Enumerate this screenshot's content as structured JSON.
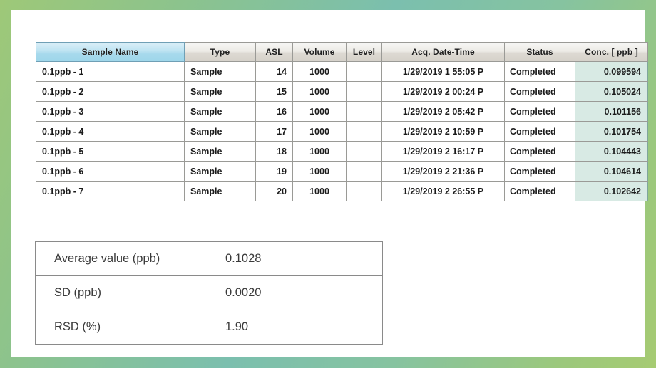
{
  "frame": {
    "border_gradient_start": "#9ec878",
    "border_gradient_mid": "#7bbfae",
    "border_gradient_end": "#a6cb72",
    "page_background": "#ffffff"
  },
  "sequence_table": {
    "selected_column": "Sample Name",
    "selected_header_color": "#a6d9ec",
    "conc_cell_color": "#d8eae4",
    "headers": [
      "Sample Name",
      "Type",
      "ASL",
      "Volume",
      "Level",
      "Acq. Date-Time",
      "Status",
      "Conc. [ ppb ]"
    ],
    "rows": [
      {
        "sample_name": "0.1ppb - 1",
        "type": "Sample",
        "asl": "14",
        "volume": "1000",
        "level": "",
        "acq_date_time": "1/29/2019 1 55:05 P",
        "status": "Completed",
        "conc_ppb": "0.099594"
      },
      {
        "sample_name": "0.1ppb - 2",
        "type": "Sample",
        "asl": "15",
        "volume": "1000",
        "level": "",
        "acq_date_time": "1/29/2019 2 00:24 P",
        "status": "Completed",
        "conc_ppb": "0.105024"
      },
      {
        "sample_name": "0.1ppb - 3",
        "type": "Sample",
        "asl": "16",
        "volume": "1000",
        "level": "",
        "acq_date_time": "1/29/2019 2 05:42 P",
        "status": "Completed",
        "conc_ppb": "0.101156"
      },
      {
        "sample_name": "0.1ppb - 4",
        "type": "Sample",
        "asl": "17",
        "volume": "1000",
        "level": "",
        "acq_date_time": "1/29/2019 2 10:59 P",
        "status": "Completed",
        "conc_ppb": "0.101754"
      },
      {
        "sample_name": "0.1ppb - 5",
        "type": "Sample",
        "asl": "18",
        "volume": "1000",
        "level": "",
        "acq_date_time": "1/29/2019 2 16:17 P",
        "status": "Completed",
        "conc_ppb": "0.104443"
      },
      {
        "sample_name": "0.1ppb - 6",
        "type": "Sample",
        "asl": "19",
        "volume": "1000",
        "level": "",
        "acq_date_time": "1/29/2019 2 21:36 P",
        "status": "Completed",
        "conc_ppb": "0.104614"
      },
      {
        "sample_name": "0.1ppb - 7",
        "type": "Sample",
        "asl": "20",
        "volume": "1000",
        "level": "",
        "acq_date_time": "1/29/2019 2 26:55 P",
        "status": "Completed",
        "conc_ppb": "0.102642"
      }
    ]
  },
  "summary_table": {
    "rows": [
      {
        "label": "Average value (ppb)",
        "value": "0.1028"
      },
      {
        "label": "SD (ppb)",
        "value": "0.0020"
      },
      {
        "label": "RSD (%)",
        "value": "1.90"
      }
    ]
  }
}
